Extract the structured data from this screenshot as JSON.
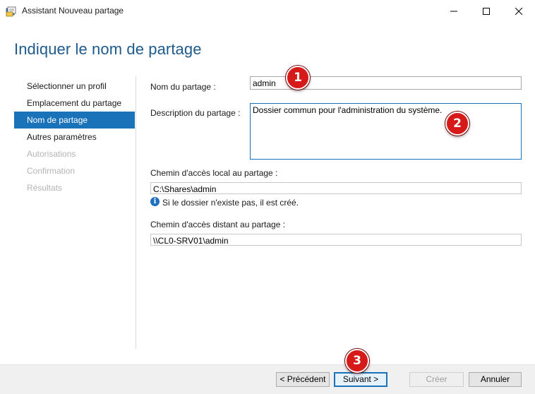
{
  "window": {
    "title": "Assistant Nouveau partage"
  },
  "header": {
    "title": "Indiquer le nom de partage"
  },
  "nav": {
    "items": [
      {
        "label": "Sélectionner un profil",
        "state": "normal"
      },
      {
        "label": "Emplacement du partage",
        "state": "normal"
      },
      {
        "label": "Nom de partage",
        "state": "active"
      },
      {
        "label": "Autres paramètres",
        "state": "normal"
      },
      {
        "label": "Autorisations",
        "state": "disabled"
      },
      {
        "label": "Confirmation",
        "state": "disabled"
      },
      {
        "label": "Résultats",
        "state": "disabled"
      }
    ]
  },
  "form": {
    "share_name_label": "Nom du partage :",
    "share_name_value": "admin",
    "description_label": "Description du partage :",
    "description_value": "Dossier commun pour l'administration du système.",
    "local_path_label": "Chemin d'accès local au partage :",
    "local_path_value": "C:\\Shares\\admin",
    "info_text": "Si le dossier n'existe pas, il est créé.",
    "remote_path_label": "Chemin d'accès distant au partage :",
    "remote_path_value": "\\\\CL0-SRV01\\admin"
  },
  "footer": {
    "previous_label": "< Précédent",
    "next_label": "Suivant >",
    "create_label": "Créer",
    "cancel_label": "Annuler"
  },
  "annotations": {
    "step1": "1",
    "step2": "2",
    "step3": "3"
  },
  "colors": {
    "accent": "#1a73b8",
    "title": "#1e5a8c",
    "badge": "#d61a1a"
  }
}
